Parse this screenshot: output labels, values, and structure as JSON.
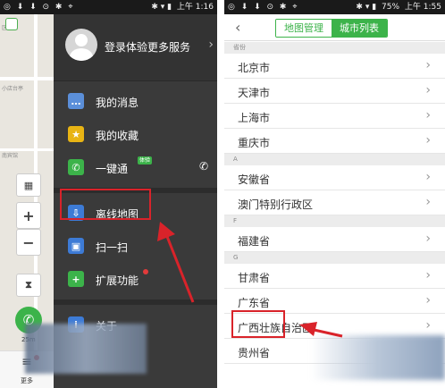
{
  "left": {
    "status": {
      "icons_left": "◎ ⬇ ⬇ ⊙ ✱ ⌖",
      "icons_right": "✱ ▾ ▮",
      "time": "上午 1:16"
    },
    "map": {
      "labels": [
        "区福地",
        "小店台亭",
        "南宾馆"
      ],
      "zoom_in": "+",
      "zoom_out": "−",
      "scale": "25m"
    },
    "more": {
      "label": "更多"
    },
    "profile": {
      "login_text": "登录体验更多服务",
      "chevron": "›"
    },
    "groups": [
      {
        "items": [
          {
            "label": "我的消息",
            "color": "#5b8fd9",
            "glyph": "…"
          },
          {
            "label": "我的收藏",
            "color": "#e8b414",
            "glyph": "★"
          },
          {
            "label": "一键通",
            "color": "#3cb34a",
            "glyph": "✆",
            "badge": "体验",
            "right": "✆"
          }
        ]
      },
      {
        "items": [
          {
            "label": "离线地图",
            "color": "#3d7bd6",
            "glyph": "⇩"
          },
          {
            "label": "扫一扫",
            "color": "#3d7bd6",
            "glyph": "▣"
          },
          {
            "label": "扩展功能",
            "color": "#3cb34a",
            "glyph": "+"
          }
        ]
      },
      {
        "items": [
          {
            "label": "关于",
            "color": "#3d7bd6",
            "glyph": "i"
          }
        ]
      }
    ]
  },
  "right": {
    "status": {
      "icons_left": "◎ ⬇ ⬇ ⊙ ✱ ⌖",
      "icons_right": "✱ ▾ ▮",
      "battery": "75%",
      "time": "上午 1:55"
    },
    "header": {
      "back": "‹",
      "tabs": [
        {
          "label": "地图管理",
          "active": false
        },
        {
          "label": "城市列表",
          "active": true
        }
      ]
    },
    "sections": [
      {
        "header": "省份",
        "rows": [
          "北京市",
          "天津市",
          "上海市",
          "重庆市"
        ]
      },
      {
        "header": "A",
        "rows": [
          "安徽省",
          "澳门特别行政区"
        ]
      },
      {
        "header": "F",
        "rows": [
          "福建省"
        ]
      },
      {
        "header": "G",
        "rows": [
          "甘肃省",
          "广东省",
          "广西壮族自治区",
          "贵州省"
        ]
      }
    ],
    "chevron": "›"
  },
  "highlight_color": "#d9232a"
}
